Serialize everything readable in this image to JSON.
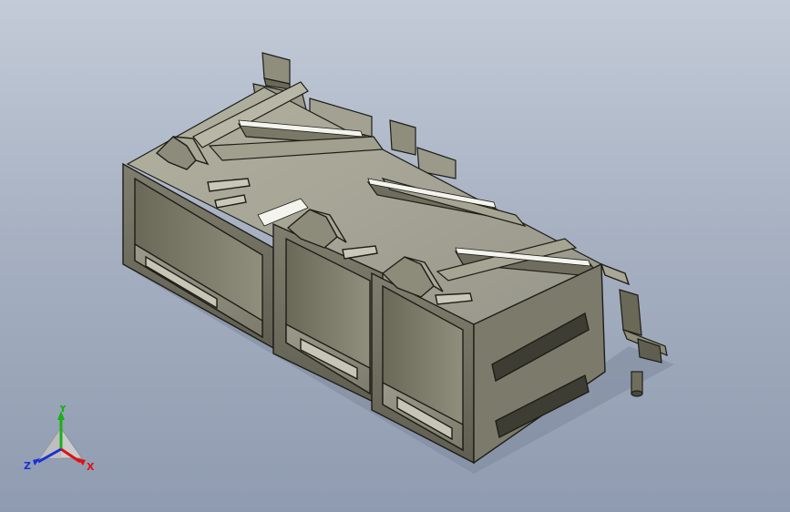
{
  "scene": {
    "subject": "connector-3d-model",
    "colors": {
      "background_top": "#c3cbd8",
      "background_bottom": "#8f9bb0",
      "body_light": "#a9a896",
      "body_mid": "#8d8c7a",
      "body_dark": "#5b5a4c",
      "body_darkest": "#3a392f",
      "edge": "#1e1e18",
      "highlight": "#f4f4ee"
    }
  },
  "triad": {
    "x_label": "X",
    "y_label": "Y",
    "z_label": "Z",
    "x_color": "#e01010",
    "y_color": "#18b018",
    "z_color": "#1830d8"
  }
}
